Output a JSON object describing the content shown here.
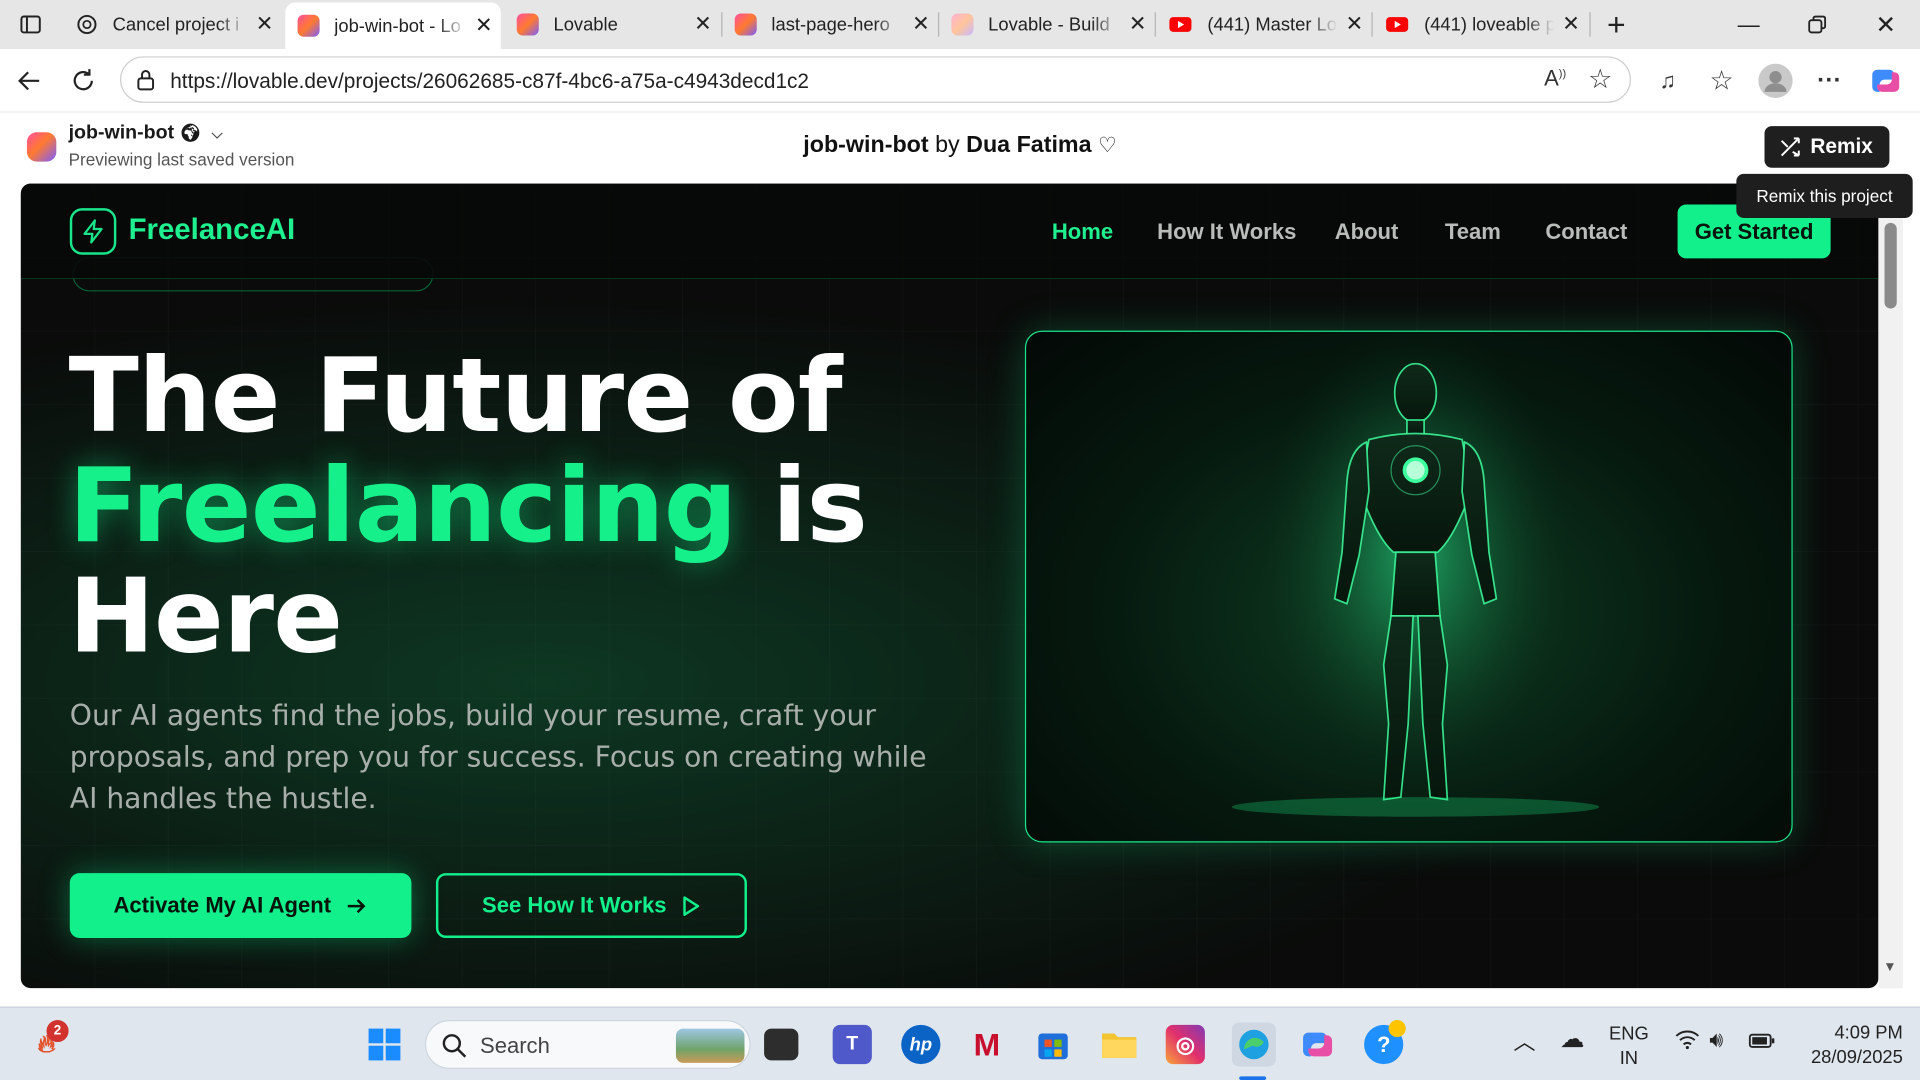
{
  "browser": {
    "tabs": [
      {
        "title": "Cancel project i",
        "icon": "chatgpt-icon"
      },
      {
        "title": "job-win-bot - Lo",
        "icon": "lovable-icon",
        "active": true
      },
      {
        "title": "Lovable",
        "icon": "lovable-icon"
      },
      {
        "title": "last-page-hero",
        "icon": "lovable-icon"
      },
      {
        "title": "Lovable - Build",
        "icon": "lovable-icon"
      },
      {
        "title": "(441) Master Lo",
        "icon": "youtube-icon"
      },
      {
        "title": "(441) loveable p",
        "icon": "youtube-icon"
      }
    ],
    "url": "https://lovable.dev/projects/26062685-c87f-4bc6-a75a-c4943decd1c2"
  },
  "lovable": {
    "project_name": "job-win-bot",
    "status": "Previewing last saved version",
    "center_project": "job-win-bot",
    "center_by": "by",
    "center_author": "Dua Fatima",
    "remix_label": "Remix",
    "tooltip": "Remix this project"
  },
  "site": {
    "brand": "FreelanceAI",
    "nav": [
      "Home",
      "How It Works",
      "About",
      "Team",
      "Contact"
    ],
    "cta_nav": "Get Started",
    "headline_1": "The Future of",
    "headline_green": "Freelancing",
    "headline_2": "is",
    "headline_3": "Here",
    "lead": "Our AI agents find the jobs, build your resume, craft your proposals, and prep you for success. Focus on creating while AI handles the hustle.",
    "primary_cta": "Activate My AI Agent",
    "secondary_cta": "See How It Works",
    "accent": "#12f08c"
  },
  "taskbar": {
    "search_placeholder": "Search",
    "notif_count": "2",
    "lang_1": "ENG",
    "lang_2": "IN",
    "time": "4:09 PM",
    "date": "28/09/2025"
  }
}
